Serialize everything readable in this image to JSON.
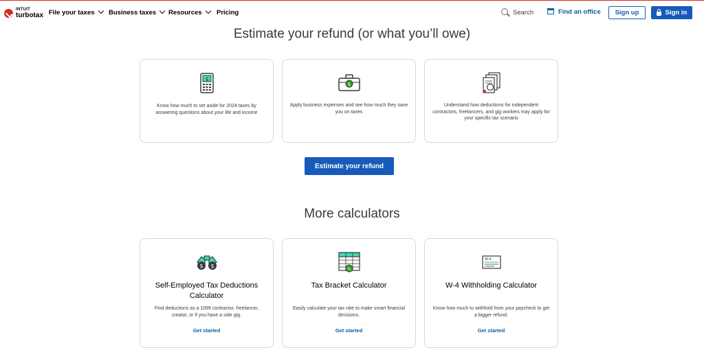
{
  "brand": {
    "line1": "INTUIT",
    "line2": "turbotax"
  },
  "nav": {
    "items": [
      {
        "label": "File your taxes",
        "chevron": true
      },
      {
        "label": "Business taxes",
        "chevron": true
      },
      {
        "label": "Resources",
        "chevron": true
      },
      {
        "label": "Pricing",
        "chevron": false
      }
    ],
    "search_label": "Search",
    "find_office_label": "Find an office",
    "signup_label": "Sign up",
    "signin_label": "Sign in"
  },
  "estimate": {
    "heading": "Estimate your refund (or what you’ll owe)",
    "cards": [
      {
        "icon": "calculator-icon",
        "text": "Know how much to set aside for 2024 taxes by answering questions about your life and income"
      },
      {
        "icon": "briefcase-icon",
        "text": "Apply business expenses and see how much they save you on taxes"
      },
      {
        "icon": "documents-icon",
        "text": "Understand how deductions for independent contractors, freelancers, and gig workers may apply for your specific tax scenario"
      }
    ],
    "button_label": "Estimate your refund"
  },
  "more": {
    "heading": "More calculators",
    "cards": [
      {
        "icon": "binoculars-icon",
        "title": "Self-Employed Tax Deductions Calculator",
        "text": "Find deductions as a 1099 contractor, freelancer, creator, or if you have a side gig.",
        "link": "Get started"
      },
      {
        "icon": "tax-table-icon",
        "title": "Tax Bracket Calculator",
        "text": "Easily calculate your tax rate to make smart financial decisions.",
        "link": "Get started"
      },
      {
        "icon": "w4-form-icon",
        "title": "W-4 Withholding Calculator",
        "text": "Know how much to withhold from your paycheck to get a bigger refund.",
        "link": "Get started"
      }
    ]
  },
  "colors": {
    "brand_red": "#d52b1e",
    "primary_blue": "#185ab9",
    "link_blue": "#0b5f99",
    "accent_teal": "#2ca01c"
  }
}
